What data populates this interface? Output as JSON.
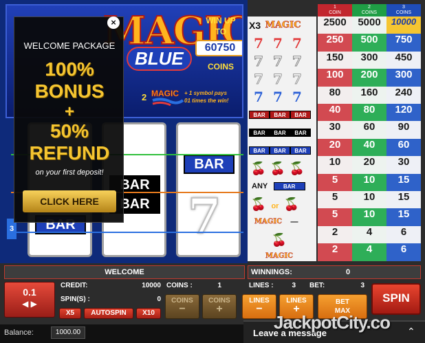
{
  "banner": {
    "logo_top": "MAGIC",
    "logo_bottom": "BLUE",
    "win_up_to": "WIN UP\nTO",
    "win_amount": "60750",
    "win_coins": "COINS",
    "promo_number": "2",
    "promo_logo": "MAGIC",
    "promo_text": "+ 1 symbol pays\n01 times the win!"
  },
  "welcome": {
    "title": "WELCOME PACKAGE",
    "line1": "100%",
    "line2": "BONUS",
    "line3": "+",
    "line4": "50%",
    "line5": "REFUND",
    "subtitle": "on your first deposit!",
    "cta": "CLICK HERE",
    "close": "×"
  },
  "reels": {
    "bar_label": "BAR",
    "seven": "7",
    "line_badge": "3"
  },
  "paytable": {
    "headers": [
      "1\nCOIN",
      "2\nCOINS",
      "3\nCOINS"
    ],
    "multiplier": "X3",
    "any_label": "ANY",
    "bar_label": "BAR",
    "or_label": "or",
    "rows": [
      {
        "c1": "2500",
        "c2": "5000",
        "c3": "10000"
      },
      {
        "c1": "250",
        "c2": "500",
        "c3": "750"
      },
      {
        "c1": "150",
        "c2": "300",
        "c3": "450"
      },
      {
        "c1": "100",
        "c2": "200",
        "c3": "300"
      },
      {
        "c1": "80",
        "c2": "160",
        "c3": "240"
      },
      {
        "c1": "40",
        "c2": "80",
        "c3": "120"
      },
      {
        "c1": "30",
        "c2": "60",
        "c3": "90"
      },
      {
        "c1": "20",
        "c2": "40",
        "c3": "60"
      },
      {
        "c1": "10",
        "c2": "20",
        "c3": "30"
      },
      {
        "c1": "5",
        "c2": "10",
        "c3": "15"
      },
      {
        "c1": "5",
        "c2": "10",
        "c3": "15"
      },
      {
        "c1": "5",
        "c2": "10",
        "c3": "15"
      },
      {
        "c1": "2",
        "c2": "4",
        "c3": "6"
      },
      {
        "c1": "2",
        "c2": "4",
        "c3": "6"
      }
    ]
  },
  "status": {
    "message": "WELCOME",
    "winnings_label": "WINNINGS:",
    "winnings_value": "0"
  },
  "controls": {
    "bet_value": "0.1",
    "credit_label": "CREDIT:",
    "credit_value": "10000",
    "spins_label": "SPIN(S) :",
    "spins_value": "0",
    "coins_label": "COINS :",
    "coins_value": "1",
    "lines_label": "LINES :",
    "lines_value": "3",
    "bet_label": "BET:",
    "bet_total": "3",
    "x5": "X5",
    "autospin": "AUTOSPIN",
    "x10": "X10",
    "coins_minus": "COINS",
    "coins_plus": "COINS",
    "lines_minus": "LINES",
    "lines_plus": "LINES",
    "bet_max": "BET\nMAX",
    "spin": "SPIN"
  },
  "bottom": {
    "balance_label": "Balance:",
    "balance_value": "1000.00",
    "chat": "Leave a message",
    "watermark": "JackpotCity.co"
  }
}
